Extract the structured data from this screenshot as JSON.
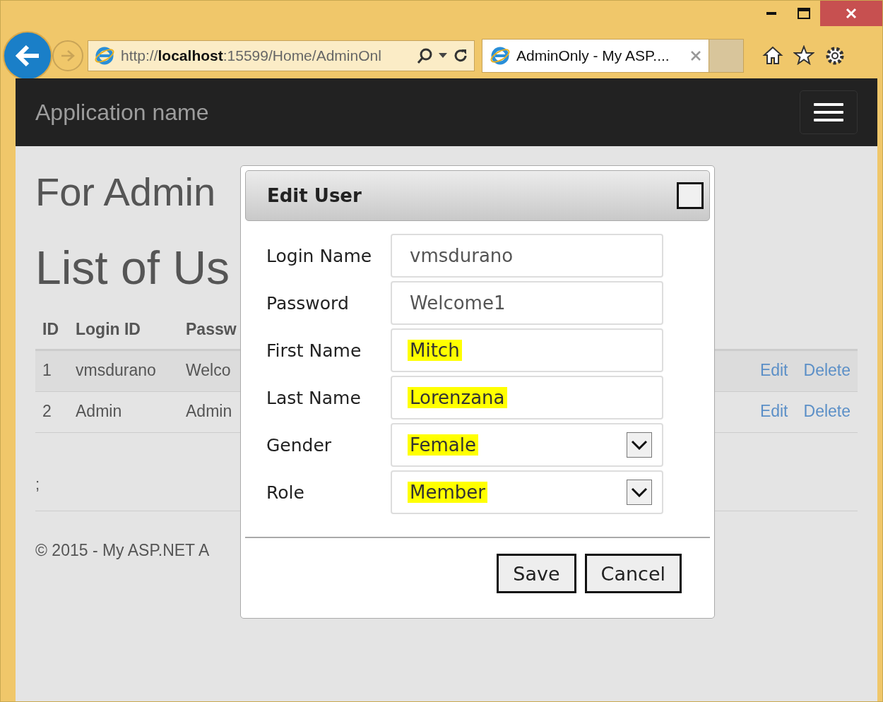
{
  "browser": {
    "address": "http://**localhost**:15599/Home/AdminOnl",
    "tabs": [
      {
        "title": "AdminOnly - My ASP....",
        "selected": true
      }
    ]
  },
  "navbar": {
    "brand": "Application name"
  },
  "page": {
    "heading": "For Admin",
    "subheading": "List of Us",
    "table": {
      "columns": [
        "ID",
        "Login ID",
        "Passw"
      ],
      "rows": [
        {
          "cells": [
            "1",
            "vmsdurano",
            "Welco"
          ],
          "actions": [
            "Edit",
            "Delete"
          ]
        },
        {
          "cells": [
            "2",
            "Admin",
            "Admin"
          ],
          "actions": [
            "Edit",
            "Delete"
          ]
        }
      ]
    },
    "note": ";",
    "footer": "© 2015 - My ASP.NET A"
  },
  "dialog": {
    "title": "Edit User",
    "fields": [
      {
        "label": "Login Name",
        "value": "vmsdurano",
        "kind": "text",
        "highlighted": false
      },
      {
        "label": "Password",
        "value": "Welcome1",
        "kind": "text",
        "highlighted": false
      },
      {
        "label": "First Name",
        "value": "Mitch",
        "kind": "text",
        "highlighted": true
      },
      {
        "label": "Last Name",
        "value": "Lorenzana",
        "kind": "text",
        "highlighted": true
      },
      {
        "label": "Gender",
        "value": "Female",
        "kind": "select",
        "highlighted": true
      },
      {
        "label": "Role",
        "value": "Member",
        "kind": "select",
        "highlighted": true
      }
    ],
    "buttons": [
      "Save",
      "Cancel"
    ]
  }
}
